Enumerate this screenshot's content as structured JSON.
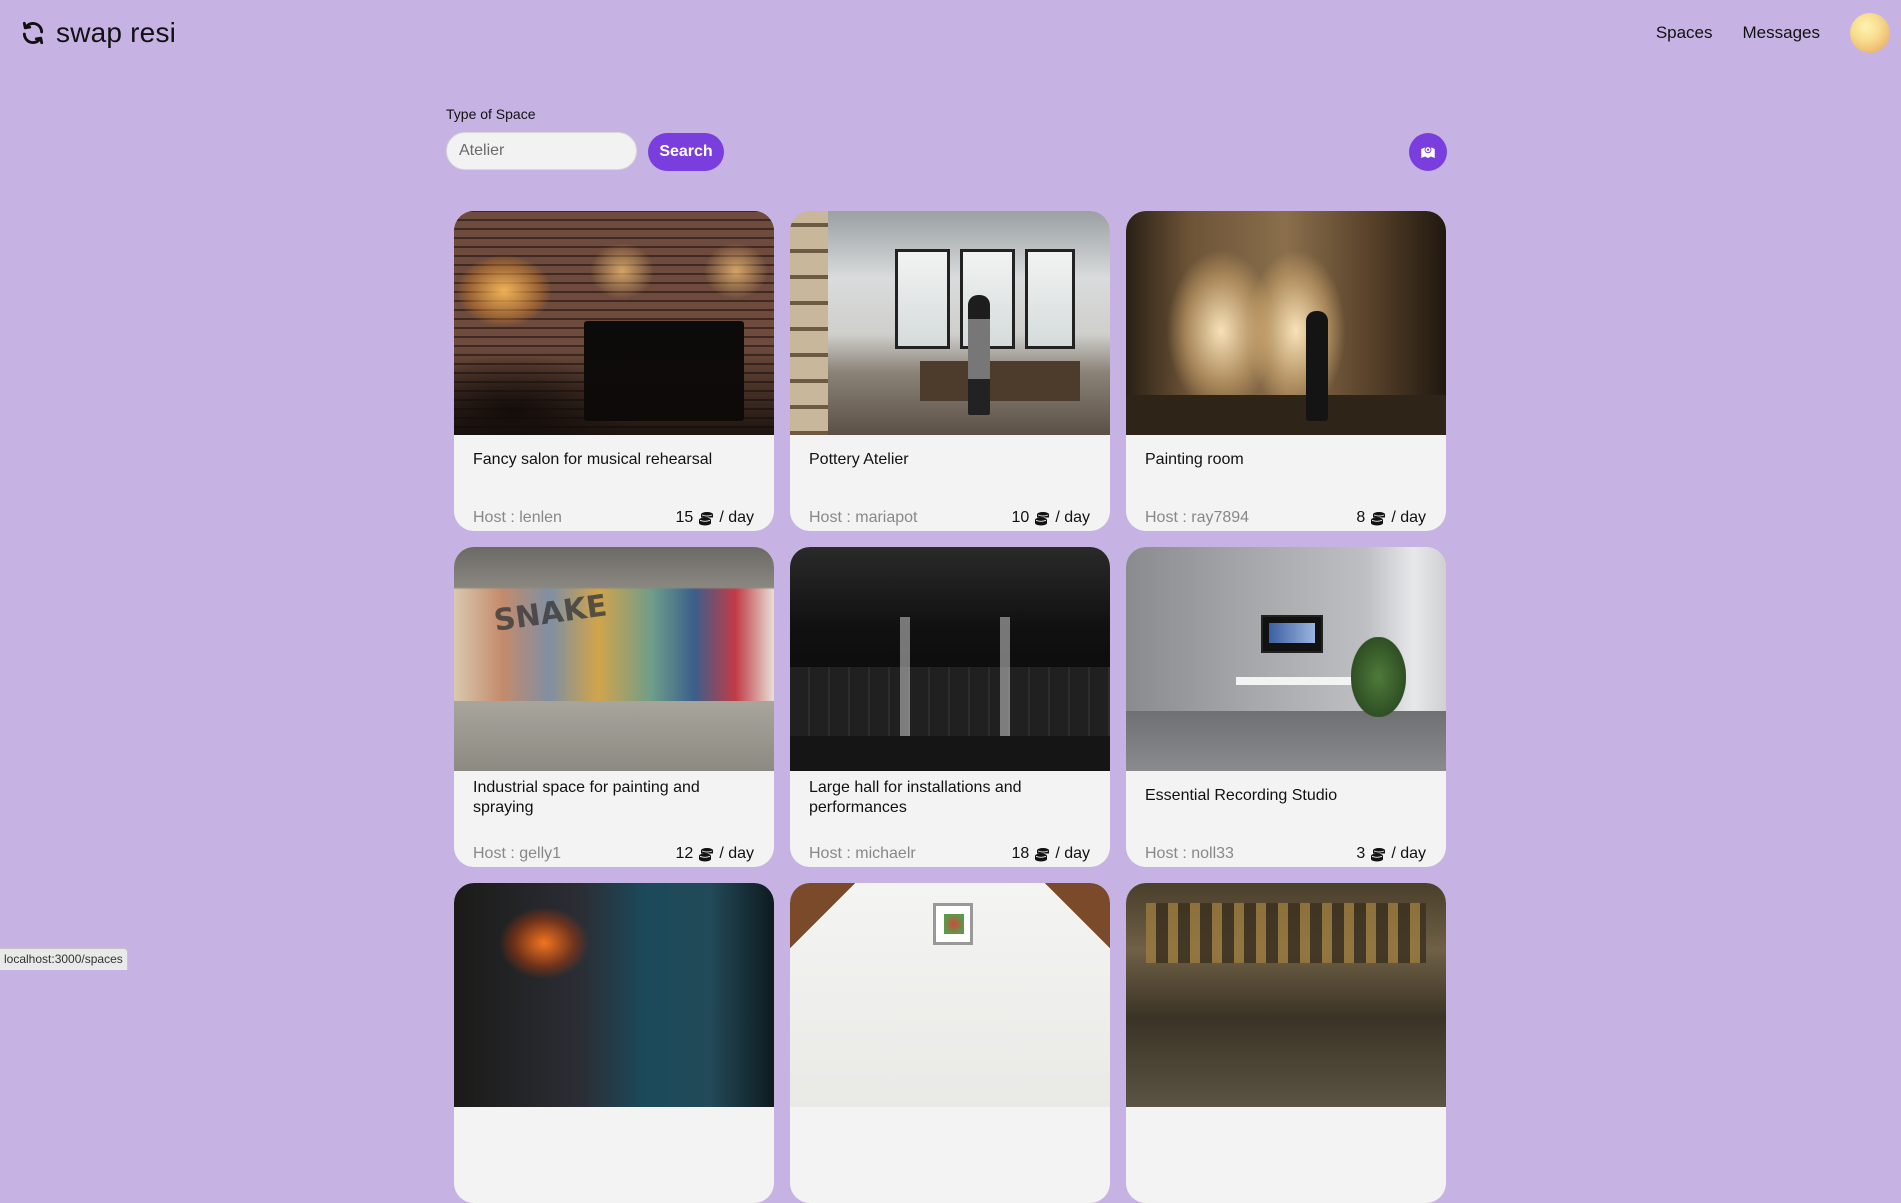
{
  "app": {
    "brand_name": "swap resi",
    "brand_icon": "refresh-icon"
  },
  "nav": {
    "spaces": "Spaces",
    "messages": "Messages"
  },
  "search": {
    "label": "Type of Space",
    "placeholder": "Atelier",
    "value": "",
    "button_label": "Search",
    "map_icon": "map-location-icon"
  },
  "colors": {
    "background": "#c7b3e3",
    "accent": "#7a3dde",
    "card": "#f3f3f3"
  },
  "listings": [
    {
      "title": "Fancy salon for musical rehearsal",
      "host_label": "Host : ",
      "host": "lenlen",
      "price": "15",
      "unit": "/ day"
    },
    {
      "title": "Pottery Atelier",
      "host_label": "Host : ",
      "host": "mariapot",
      "price": "10",
      "unit": "/ day"
    },
    {
      "title": "Painting room",
      "host_label": "Host : ",
      "host": "ray7894",
      "price": "8",
      "unit": "/ day"
    },
    {
      "title": "Industrial space for painting and spraying",
      "host_label": "Host : ",
      "host": "gelly1",
      "price": "12",
      "unit": "/ day"
    },
    {
      "title": "Large hall for installations and performances",
      "host_label": "Host : ",
      "host": "michaelr",
      "price": "18",
      "unit": "/ day"
    },
    {
      "title": "Essential Recording Studio",
      "host_label": "Host : ",
      "host": "noll33",
      "price": "3",
      "unit": "/ day"
    }
  ],
  "statusbar": {
    "url": "localhost:3000/spaces"
  }
}
